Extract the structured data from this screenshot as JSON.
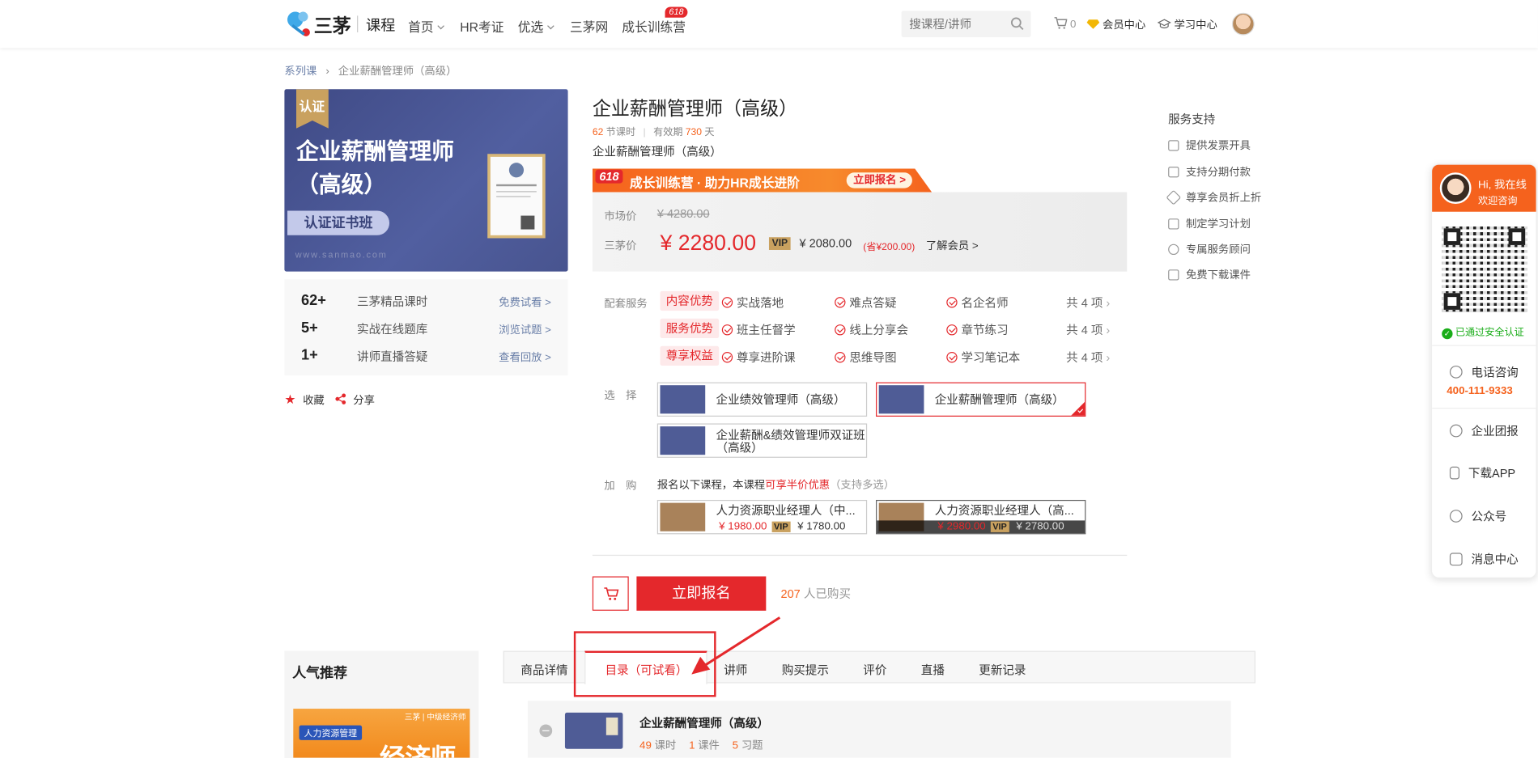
{
  "header": {
    "logo_text": "三茅",
    "logo_sub": "课程",
    "nav": [
      {
        "label": "首页",
        "caret": true
      },
      {
        "label": "HR考证",
        "caret": false
      },
      {
        "label": "优选",
        "caret": true
      },
      {
        "label": "三茅网",
        "caret": false
      },
      {
        "label": "成长训练营",
        "caret": false
      }
    ],
    "nav_badge": "618",
    "search_placeholder": "搜课程/讲师",
    "cart_count": "0",
    "vip_center": "会员中心",
    "study_center": "学习中心"
  },
  "breadcrumb": {
    "root": "系列课",
    "current": "企业薪酬管理师（高级）"
  },
  "cover": {
    "badge": "认证",
    "title_line1": "企业薪酬管理师",
    "title_line2": "（高级）",
    "pill": "认证证书班",
    "url": "www.sanmao.com"
  },
  "stats": [
    {
      "num": "62+",
      "label": "三茅精品课时",
      "action": "免费试看 >"
    },
    {
      "num": "5+",
      "label": "实战在线题库",
      "action": "浏览试题 >"
    },
    {
      "num": "1+",
      "label": "讲师直播答疑",
      "action": "查看回放 >"
    }
  ],
  "actions": {
    "favorite": "收藏",
    "share": "分享"
  },
  "product": {
    "title": "企业薪酬管理师（高级）",
    "hours": "62",
    "hours_unit": "节课时",
    "validity_label": "有效期",
    "validity": "730",
    "validity_unit": "天",
    "subtitle": "企业薪酬管理师（高级）"
  },
  "promo": {
    "badge": "618",
    "text": "成长训练营 · 助力HR成长进阶",
    "button": "立即报名 >"
  },
  "price": {
    "market_label": "市场价",
    "market_price": "¥ 4280.00",
    "sanmao_label": "三茅价",
    "sanmao_price": "¥ 2280.00",
    "vip_tag": "VIP",
    "vip_price": "¥ 2080.00",
    "vip_save": "(省¥200.00)",
    "vip_more": "了解会员 >"
  },
  "services": {
    "label": "配套服务",
    "rows": [
      {
        "tag": "内容优势",
        "items": [
          "实战落地",
          "难点答疑",
          "名企名师"
        ],
        "total": "共 4 项"
      },
      {
        "tag": "服务优势",
        "items": [
          "班主任督学",
          "线上分享会",
          "章节练习"
        ],
        "total": "共 4 项"
      },
      {
        "tag": "尊享权益",
        "items": [
          "尊享进阶课",
          "思维导图",
          "学习笔记本"
        ],
        "total": "共 4 项"
      }
    ]
  },
  "select": {
    "label": "选　择",
    "options": [
      "企业绩效管理师（高级）",
      "企业薪酬管理师（高级）",
      "企业薪酬&绩效管理师双证班（高级）"
    ],
    "selected_index": 1
  },
  "addon": {
    "label": "加　购",
    "hint_prefix": "报名以下课程，本课程",
    "hint_highlight": "可享半价优惠",
    "hint_suffix": "（支持多选）",
    "items": [
      {
        "title": "人力资源职业经理人（中...",
        "price": "¥ 1980.00",
        "vip_tag": "VIP",
        "vip_price": "¥ 1780.00"
      },
      {
        "title": "人力资源职业经理人（高...",
        "price": "¥ 2980.00",
        "vip_tag": "VIP",
        "vip_price": "¥ 2780.00"
      }
    ]
  },
  "buy": {
    "button": "立即报名",
    "count": "207",
    "count_suffix": "人已购买"
  },
  "service_support": {
    "title": "服务支持",
    "items": [
      "提供发票开具",
      "支持分期付款",
      "尊享会员折上折",
      "制定学习计划",
      "专属服务顾问",
      "免费下载课件"
    ]
  },
  "float_panel": {
    "greeting": "Hi, 我在线",
    "greeting_sub": "欢迎咨询",
    "verified": "已通过安全认证",
    "phone_label": "电话咨询",
    "phone": "400-111-9333",
    "items": [
      "企业团报",
      "下载APP",
      "公众号",
      "消息中心"
    ]
  },
  "recommend": {
    "title": "人气推荐",
    "card_tag": "人力资源管理",
    "card_brand": "三茅 | 中级经济师",
    "card_big": "经济师"
  },
  "tabs": [
    "商品详情",
    "目录（可试看）",
    "讲师",
    "购买提示",
    "评价",
    "直播",
    "更新记录"
  ],
  "active_tab": 1,
  "catalog": {
    "title": "企业薪酬管理师（高级）",
    "lessons": "49",
    "lessons_unit": "课时",
    "courseware": "1",
    "courseware_unit": "课件",
    "exercises": "5",
    "exercises_unit": "习题"
  },
  "colors": {
    "accent": "#e4282c",
    "promo": "#f5621d",
    "vip_gold": "#c9a15f",
    "link": "#6a7fa8"
  }
}
